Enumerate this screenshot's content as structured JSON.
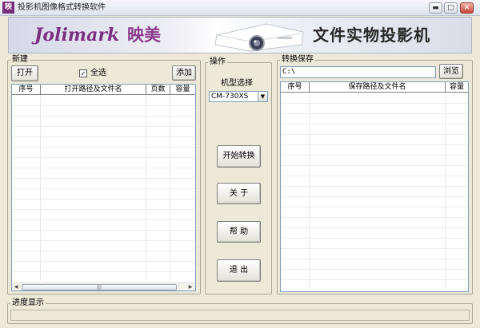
{
  "window": {
    "title": "投影机图像格式转换软件",
    "app_icon_glyph": "映",
    "minimize_glyph": "▬",
    "maximize_glyph": "□",
    "close_glyph": "✕"
  },
  "banner": {
    "brand": "Jolimark",
    "brand_cn": "映美",
    "slogan": "文件实物投影机"
  },
  "new_panel": {
    "legend": "新建",
    "open_button": "打开",
    "select_all_label": "全选",
    "select_all_checked": true,
    "checkmark": "✓",
    "add_button": "添加",
    "columns": [
      "序号",
      "打开路径及文件名",
      "页数",
      "容量"
    ],
    "rows": []
  },
  "operation_panel": {
    "legend": "操作",
    "model_label": "机型选择",
    "model_value": "CM-730XS",
    "start_button": "开始转换",
    "about_button": "关 于",
    "help_button": "帮 助",
    "exit_button": "退 出"
  },
  "save_panel": {
    "legend": "转换保存",
    "path_value": "C:\\",
    "browse_button": "浏览",
    "columns": [
      "序号",
      "保存路径及文件名",
      "容量"
    ],
    "rows": []
  },
  "progress_panel": {
    "legend": "进度显示",
    "value": 0
  },
  "scroll": {
    "left_arrow": "◀",
    "right_arrow": "▶",
    "grip": "|||"
  },
  "colors": {
    "brand_purple": "#7b2f7e",
    "window_bg": "#ece9d8"
  }
}
